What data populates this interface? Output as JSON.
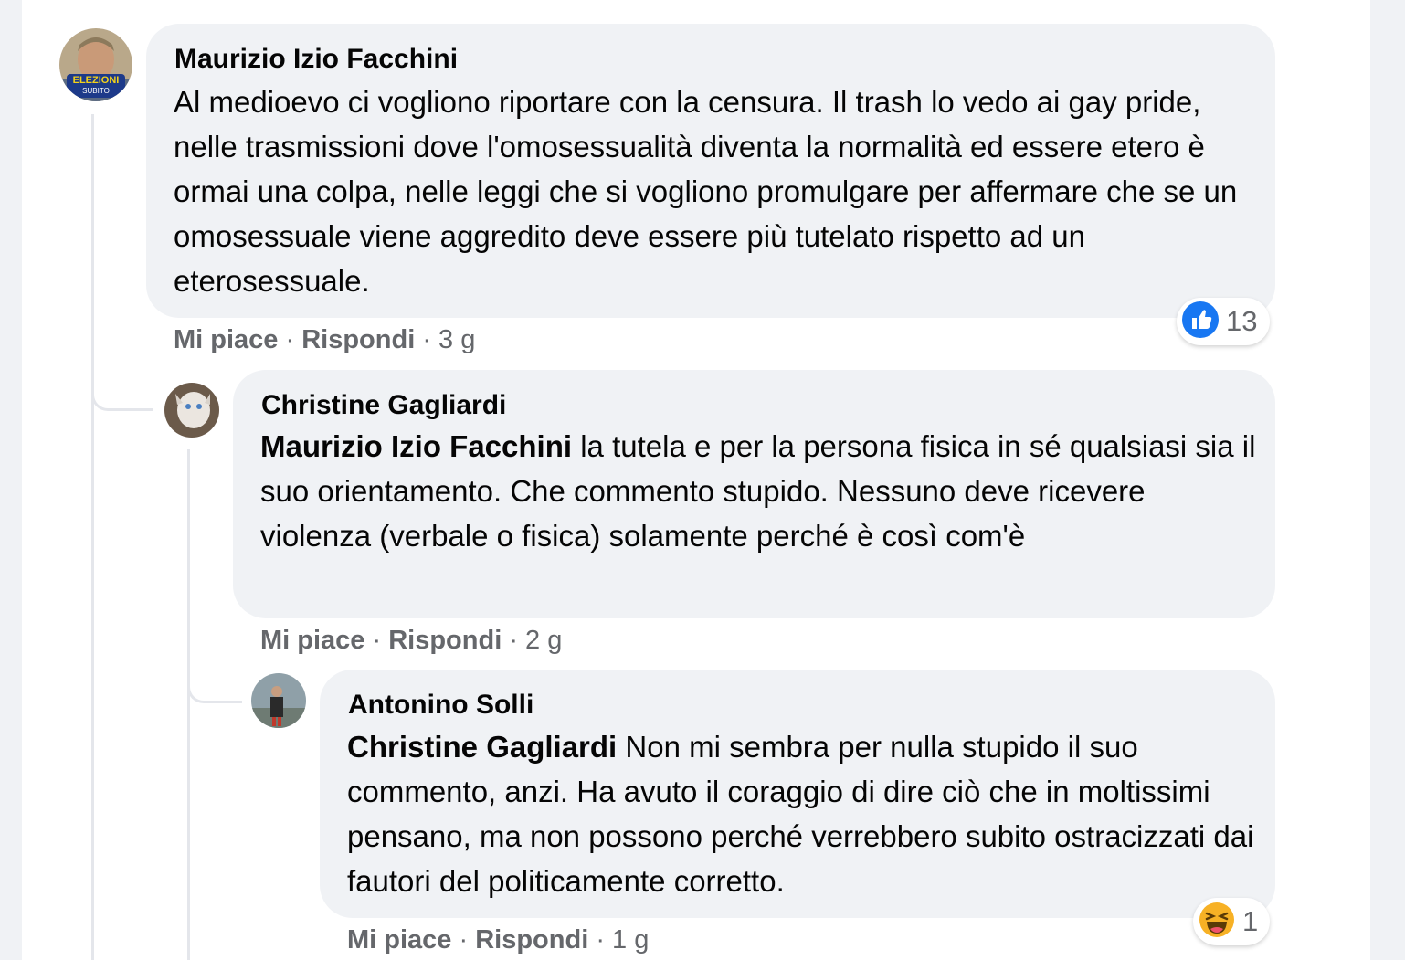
{
  "comments": [
    {
      "author": "Maurizio Izio Facchini",
      "avatar_badge": {
        "line1": "ELEZIONI",
        "line2": "SUBITO"
      },
      "text": "Al medioevo ci vogliono riportare con la censura. Il trash lo vedo ai gay pride, nelle trasmissioni dove l'omosessualità diventa la normalità ed essere etero è ormai una colpa, nelle leggi che si vogliono promulgare per affermare che se un omosessuale viene aggredito deve essere più tutelato rispetto ad un eterosessuale.",
      "like_label": "Mi piace",
      "reply_label": "Rispondi",
      "separator": "·",
      "time": "3 g",
      "reaction": {
        "icon": "thumbs-up-icon",
        "count": "13",
        "color": "#1877f2"
      }
    },
    {
      "author": "Christine Gagliardi",
      "mention": "Maurizio Izio Facchini",
      "text": " la tutela e per la persona fisica in sé qualsiasi sia il suo orientamento. Che commento stupido. Nessuno deve ricevere violenza (verbale o fisica) solamente perché è così com'è",
      "like_label": "Mi piace",
      "reply_label": "Rispondi",
      "separator": "·",
      "time": "2 g"
    },
    {
      "author": "Antonino Solli",
      "mention": "Christine Gagliardi",
      "text": " Non mi sembra per nulla stupido il suo commento, anzi. Ha avuto il coraggio di dire ciò che in moltissimi pensano, ma non possono perché verrebbero subito ostracizzati dai fautori del politicamente corretto.",
      "like_label": "Mi piace",
      "reply_label": "Rispondi",
      "separator": "·",
      "time": "1 g",
      "reaction": {
        "icon": "laughing-emoji-icon",
        "count": "1",
        "color": "#f7b125"
      }
    }
  ]
}
